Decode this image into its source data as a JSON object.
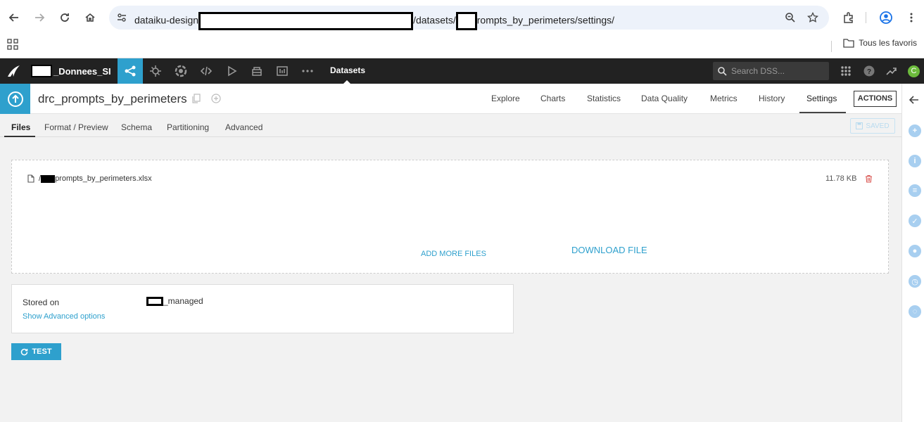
{
  "browser": {
    "url_prefix": "dataiku-design",
    "url_mid": "/datasets/",
    "url_suffix": "rompts_by_perimeters/settings/",
    "bookmarks_label": "Tous les favoris"
  },
  "dss_nav": {
    "project_name": "_Donnees_SI",
    "section_title": "Datasets",
    "search_placeholder": "Search DSS...",
    "avatar_letter": "C"
  },
  "dataset": {
    "name": "drc_prompts_by_perimeters",
    "tabs": [
      "Explore",
      "Charts",
      "Statistics",
      "Data Quality",
      "Metrics",
      "History",
      "Settings"
    ],
    "active_tab": "Settings",
    "actions_label": "ACTIONS"
  },
  "sub_tabs": {
    "items": [
      "Files",
      "Format / Preview",
      "Schema",
      "Partitioning",
      "Advanced"
    ],
    "active": "Files",
    "saved_label": "SAVED"
  },
  "files": {
    "file_prefix": "/",
    "file_name": "prompts_by_perimeters.xlsx",
    "file_size": "11.78 KB",
    "add_more_label": "ADD MORE FILES",
    "download_label": "DOWNLOAD FILE"
  },
  "storage": {
    "stored_on_label": "Stored on",
    "stored_on_value": "_managed",
    "advanced_link": "Show Advanced options"
  },
  "test_button": {
    "label": "TEST"
  },
  "colors": {
    "accent": "#2ea0cd",
    "nav_bg": "#222222",
    "danger": "#d9534f"
  }
}
